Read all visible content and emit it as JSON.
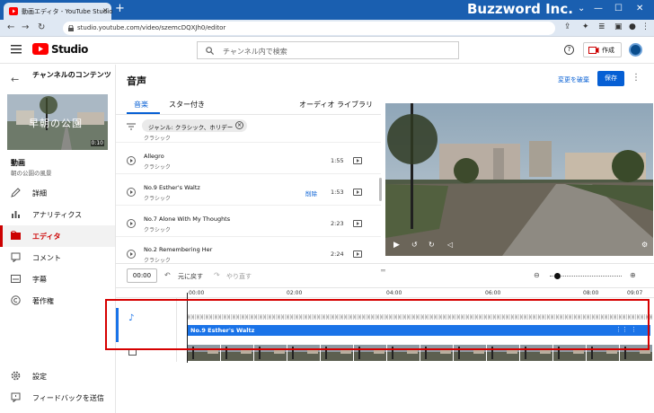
{
  "browser": {
    "tab_title": "動画エディタ - YouTube Studio",
    "tab_close": "×",
    "new_tab": "+",
    "url": "studio.youtube.com/video/szemcDQXJh0/editor",
    "watermark": "Buzzword Inc.",
    "window_controls": [
      "⌄",
      "—",
      "☐",
      "✕"
    ]
  },
  "header": {
    "logo_text": "Studio",
    "search_placeholder": "チャンネル内で検索",
    "create_label": "作成"
  },
  "sidebar": {
    "back_title": "チャンネルのコンテンツ",
    "thumb_title": "早朝の公園",
    "thumb_duration": "0:10",
    "video_label": "動画",
    "video_name": "朝の公園の風景",
    "items": [
      {
        "label": "詳細",
        "icon": "pencil-icon"
      },
      {
        "label": "アナリティクス",
        "icon": "analytics-icon"
      },
      {
        "label": "エディタ",
        "icon": "editor-icon",
        "active": true
      },
      {
        "label": "コメント",
        "icon": "comment-icon"
      },
      {
        "label": "字幕",
        "icon": "subtitles-icon"
      },
      {
        "label": "著作権",
        "icon": "copyright-icon"
      }
    ],
    "bottom_items": [
      {
        "label": "設定",
        "icon": "gear-icon"
      },
      {
        "label": "フィードバックを送信",
        "icon": "feedback-icon"
      }
    ]
  },
  "main": {
    "title": "音声",
    "revert_label": "変更を破棄",
    "save_label": "保存"
  },
  "audio": {
    "tabs": {
      "music": "音楽",
      "starred": "スター付き",
      "library": "オーディオ ライブラリ"
    },
    "filter_chip": "ジャンル: クラシック、ホリデー",
    "partial_genre": "クラシック",
    "tracks": [
      {
        "name": "Allegro",
        "genre": "クラシック",
        "duration": "1:55",
        "action": ""
      },
      {
        "name": "No.9 Esther's Waltz",
        "genre": "クラシック",
        "duration": "1:53",
        "action": "削除"
      },
      {
        "name": "No.7 Alone With My Thoughts",
        "genre": "クラシック",
        "duration": "2:23",
        "action": ""
      },
      {
        "name": "No.2 Remembering Her",
        "genre": "クラシック",
        "duration": "2:24",
        "action": ""
      }
    ]
  },
  "timeline": {
    "current_time": "00:00",
    "undo_label": "元に戻す",
    "redo_label": "やり直す",
    "markers": [
      "00:00",
      "02:00",
      "04:00",
      "06:00",
      "08:00",
      "09:07"
    ],
    "audio_clip_label": "No.9 Esther's Waltz",
    "zoom_level": 0.1
  },
  "colors": {
    "accent": "#065fd4",
    "active": "#cc0000",
    "highlight_box": "#d60000",
    "audio_clip": "#1a73e8"
  }
}
